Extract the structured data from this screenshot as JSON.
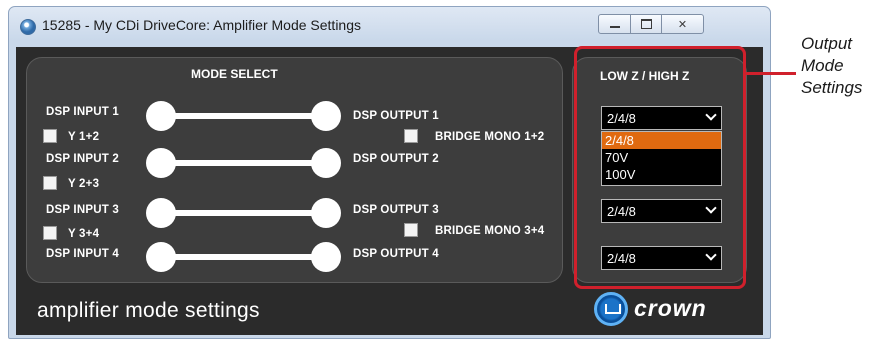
{
  "window": {
    "title": "15285 - My CDi DriveCore: Amplifier Mode Settings",
    "buttons": {
      "minimize_icon": "minimize-icon",
      "maximize_icon": "maximize-icon",
      "close_icon": "close-icon",
      "close_glyph": "✕"
    }
  },
  "mode_select": {
    "header": "MODE SELECT",
    "inputs": [
      "DSP INPUT 1",
      "DSP INPUT 2",
      "DSP INPUT 3",
      "DSP INPUT 4"
    ],
    "outputs": [
      "DSP OUTPUT 1",
      "DSP OUTPUT 2",
      "DSP OUTPUT 3",
      "DSP OUTPUT 4"
    ],
    "y_checks": [
      {
        "label": "Y 1+2",
        "checked": false
      },
      {
        "label": "Y 2+3",
        "checked": false
      },
      {
        "label": "Y 3+4",
        "checked": false
      }
    ],
    "bridge_checks": [
      {
        "label": "BRIDGE MONO 1+2",
        "checked": false
      },
      {
        "label": "BRIDGE MONO 3+4",
        "checked": false
      }
    ]
  },
  "impedance": {
    "header": "LOW Z / HIGH Z",
    "selects": [
      "2/4/8",
      "2/4/8",
      "2/4/8"
    ],
    "dropdown_options": [
      "2/4/8",
      "70V",
      "100V"
    ],
    "dropdown_selected": "2/4/8"
  },
  "footer": {
    "title": "amplifier mode settings",
    "logo_text": "crown"
  },
  "callout": {
    "lines": [
      "Output",
      "Mode",
      "Settings"
    ]
  },
  "colors": {
    "highlight": "#e06a10",
    "callout": "#d0202c",
    "panel": "#3d3d3d",
    "client": "#2b2b2b"
  }
}
